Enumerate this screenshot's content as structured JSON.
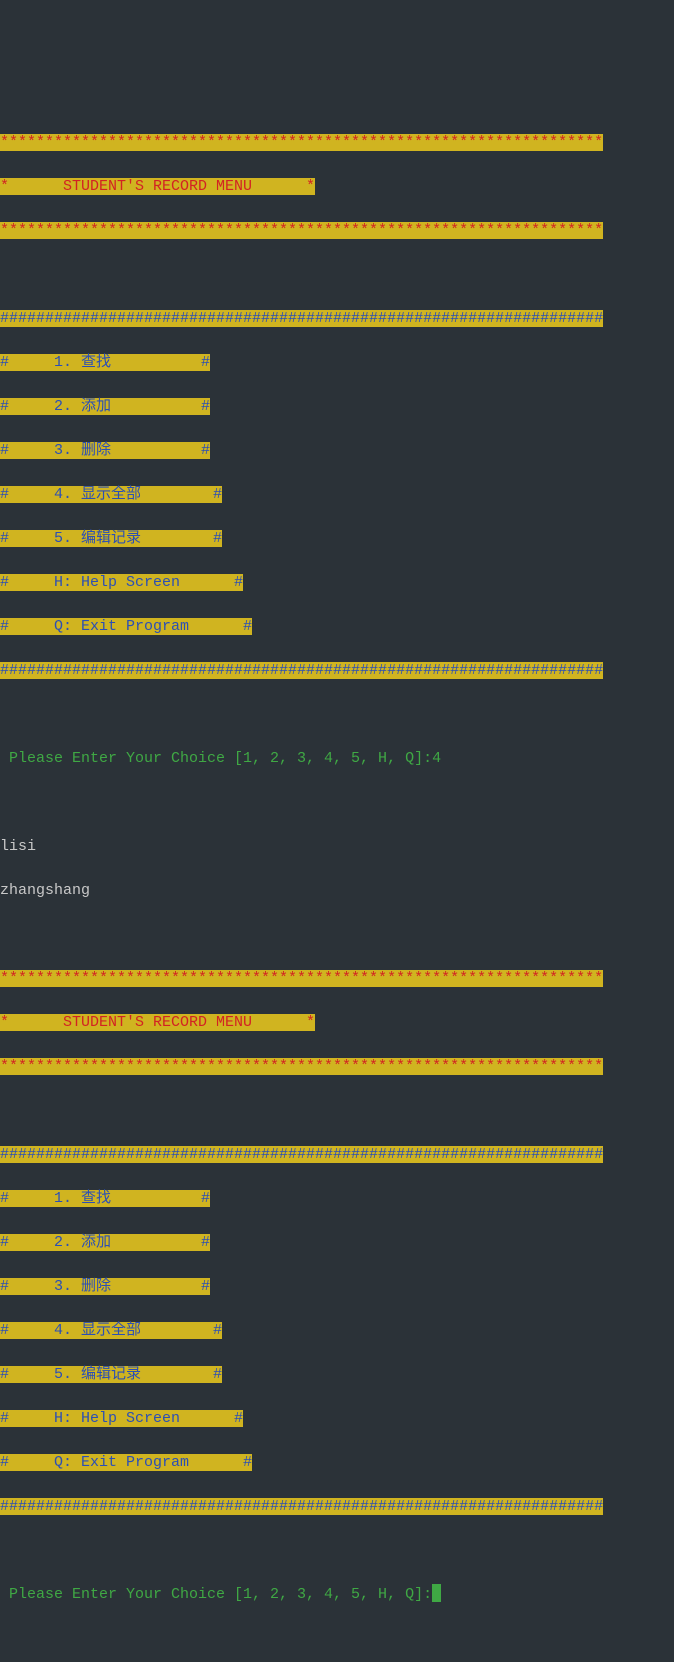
{
  "header": {
    "stars_top": "*******************************************************************",
    "title_line": "*      STUDENT'S RECORD MENU      *",
    "stars_bottom": "*******************************************************************"
  },
  "menu": {
    "hash_top": "###################################################################",
    "items": [
      "#     1. 查找          #",
      "#     2. 添加          #",
      "#     3. 删除          #",
      "#     4. 显示全部        #",
      "#     5. 编辑记录        #",
      "#     H: Help Screen      #",
      "#     Q: Exit Program      #"
    ],
    "hash_bottom": "###################################################################"
  },
  "prompt": {
    "text": " Please Enter Your Choice [1, 2, 3, 4, 5, H, Q]:",
    "input1": "4",
    "input2": ""
  },
  "output": {
    "line1": "lisi",
    "line2": "zhangshang"
  }
}
